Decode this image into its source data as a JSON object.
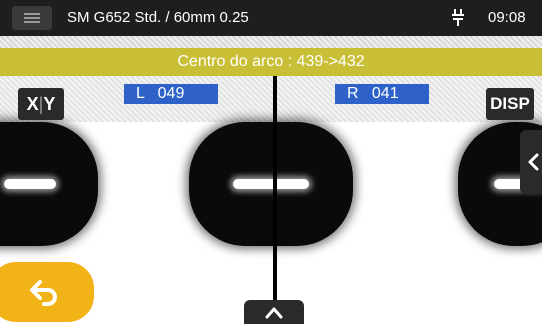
{
  "header": {
    "title": "SM G652 Std. / 60mm 0.25",
    "time": "09:08",
    "icons": {
      "menu": "hamburger-menu-icon",
      "power": "plug-icon"
    }
  },
  "banner": {
    "text": "Centro do arco : 439->432"
  },
  "labels": {
    "left": "L   049",
    "right": "R   041"
  },
  "controls": {
    "xy_x": "X",
    "xy_y": "Y",
    "disp": "DISP"
  },
  "colors": {
    "banner": "#c8bf36",
    "label_box": "#2f62c8",
    "back_button": "#f2b318",
    "topbar": "#1e1e1e"
  }
}
